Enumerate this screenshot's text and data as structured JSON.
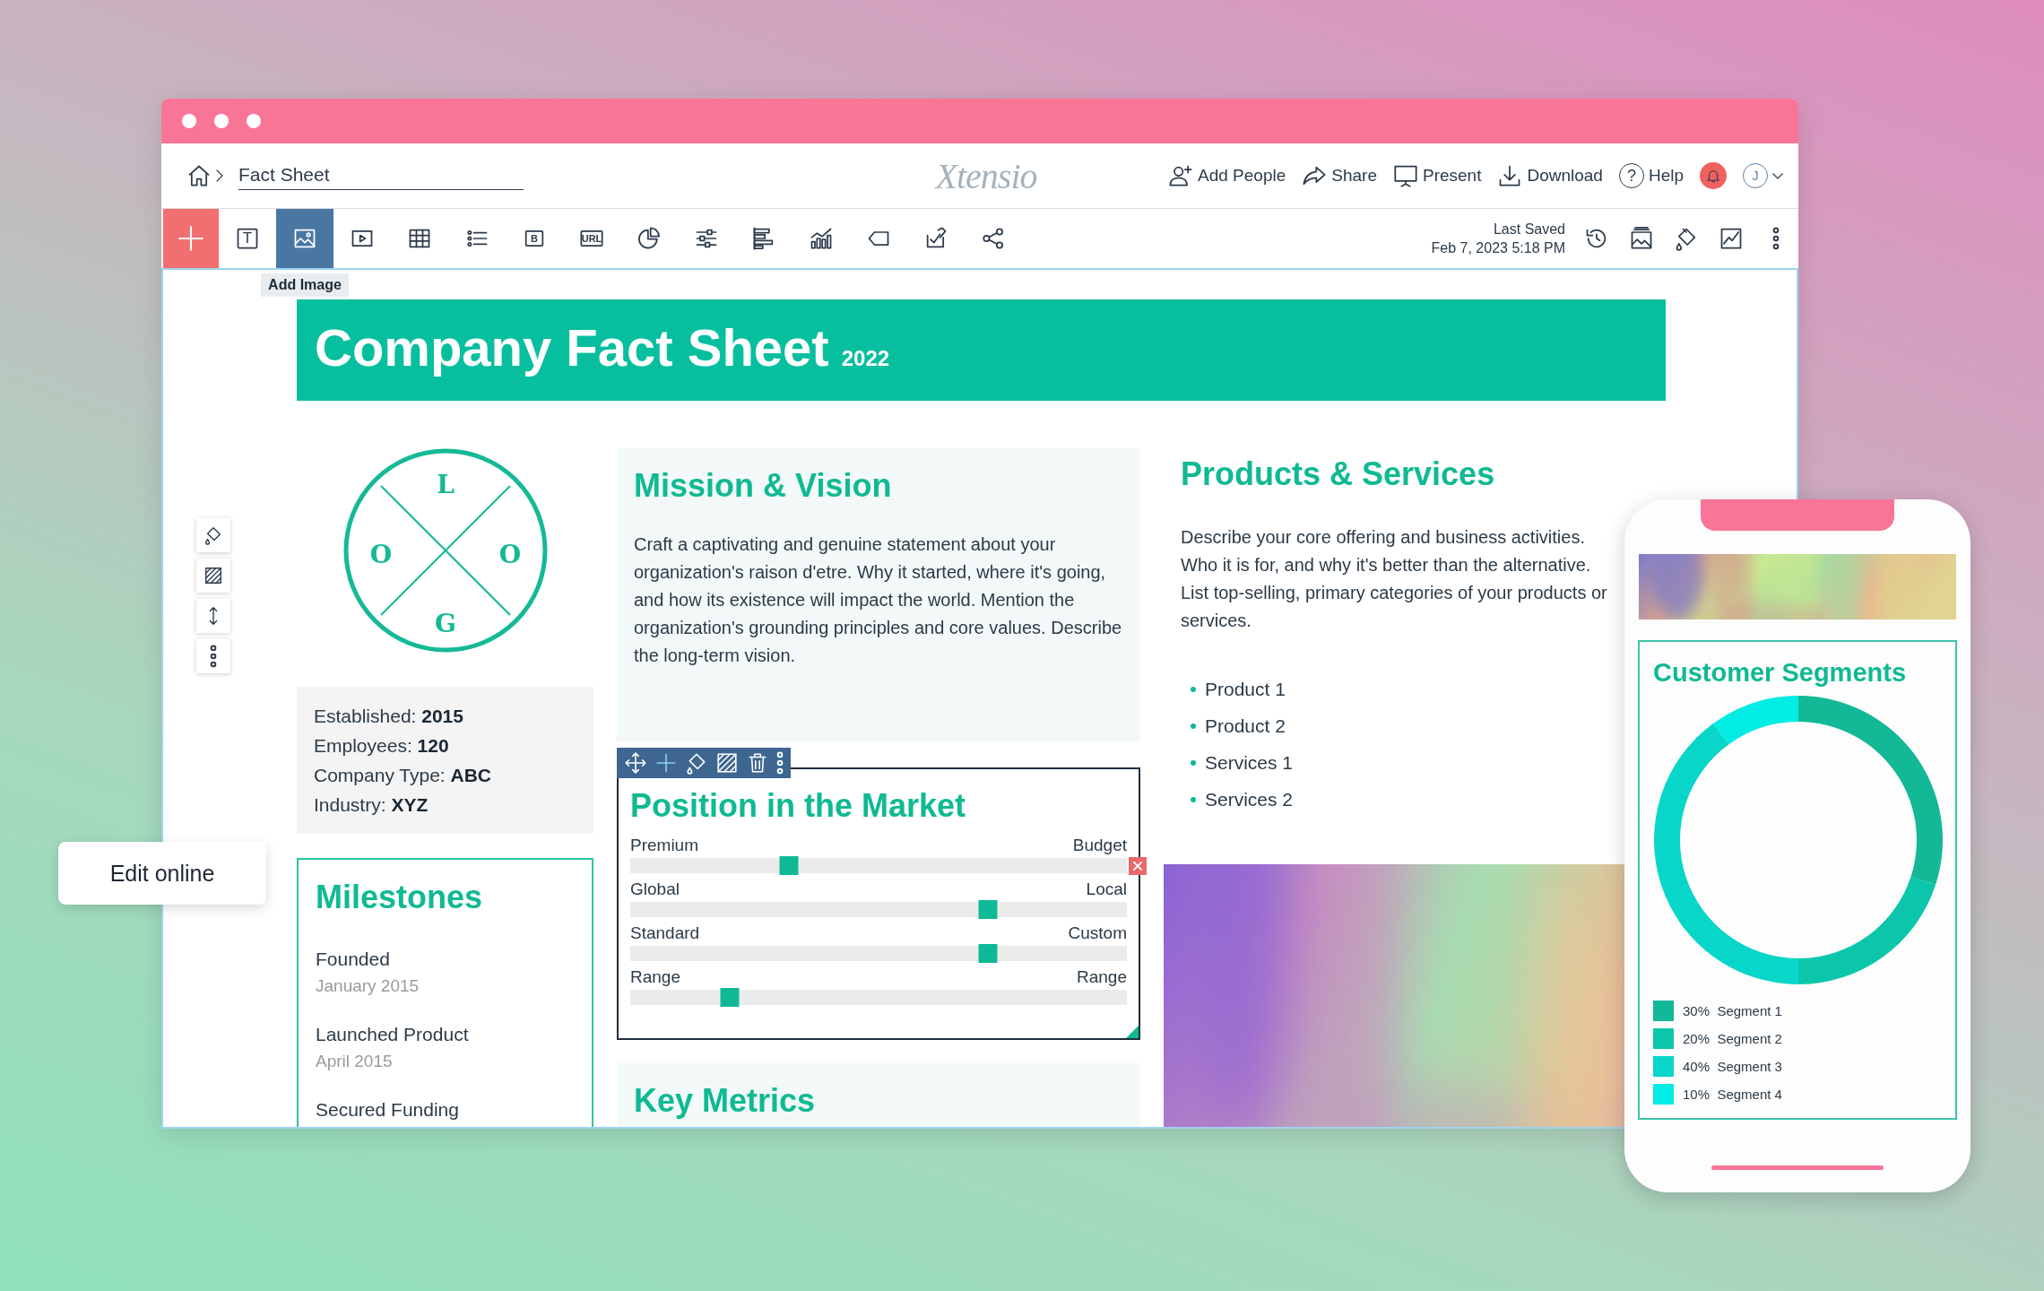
{
  "header": {
    "title_field": "Fact Sheet",
    "logo": "Xtensio",
    "actions": [
      {
        "label": "Add People"
      },
      {
        "label": "Share"
      },
      {
        "label": "Present"
      },
      {
        "label": "Download"
      },
      {
        "label": "Help",
        "glyph": "?"
      }
    ],
    "avatar_initial": "J"
  },
  "toolbar": {
    "tools": [
      {
        "selected": false,
        "glyph": "T"
      },
      {
        "selected": true,
        "tooltip": "Add Image"
      },
      {
        "selected": false
      },
      {
        "selected": false
      },
      {
        "selected": false
      },
      {
        "selected": false,
        "glyph": "B"
      },
      {
        "selected": false,
        "glyph": "URL"
      },
      {
        "selected": false
      },
      {
        "selected": false
      },
      {
        "selected": false
      },
      {
        "selected": false
      },
      {
        "selected": false
      },
      {
        "selected": false
      },
      {
        "selected": false
      }
    ],
    "last_saved_label": "Last Saved",
    "last_saved_time": "Feb 7, 2023 5:18 PM"
  },
  "document": {
    "title": "Company Fact Sheet",
    "year": "2022",
    "logo_letters": [
      "L",
      "O",
      "O",
      "G"
    ],
    "facts": [
      "Established: **2015**",
      "Employees: **120**",
      "Company Type: **ABC**",
      "Industry: **XYZ**"
    ],
    "milestones": {
      "title": "Milestones",
      "items": [
        {
          "name": "Founded",
          "date": "January 2015"
        },
        {
          "name": "Launched Product",
          "date": "April 2015"
        },
        {
          "name": "Secured Funding"
        }
      ]
    },
    "mission": {
      "title": "Mission & Vision",
      "body": "Craft a captivating and genuine statement about your organization's raison d'etre. Why it started, where it's going, and how its existence will impact the world. Mention the organization's grounding principles and core values. Describe the long-term vision."
    },
    "position": {
      "title": "Position in the Market",
      "selected": true,
      "sliders": [
        {
          "left": "Premium",
          "right": "Budget",
          "level": 0.32,
          "hovered": true
        },
        {
          "left": "Global",
          "right": "Local",
          "level": 0.72,
          "hovered": false
        },
        {
          "left": "Standard",
          "right": "Custom",
          "level": 0.72,
          "hovered": false
        },
        {
          "left": "Range",
          "right": "Range",
          "level": 0.2,
          "hovered": false
        }
      ]
    },
    "key_metrics": {
      "title": "Key Metrics"
    },
    "products": {
      "title": "Products & Services",
      "body": "Describe your core offering and business activities. Who it is for, and why it's better than the alternative. List top-selling, primary categories of your products or services.",
      "items": [
        "Product 1",
        "Product 2",
        "Services 1",
        "Services 2"
      ]
    }
  },
  "edit_online": "Edit online",
  "phone": {
    "segments": {
      "title": "Customer Segments",
      "legend": [
        {
          "percent": "30%",
          "color": "#13b896"
        },
        {
          "percent": "20%",
          "color": "#0cc6ab"
        },
        {
          "percent": "40%",
          "color": "#07d6c8"
        },
        {
          "percent": "10%",
          "color": "#00ece4"
        }
      ],
      "chart_data": {
        "type": "donut",
        "categories": [
          "Segment 1",
          "Segment 2",
          "Segment 3",
          "Segment 4"
        ],
        "values": [
          30,
          20,
          40,
          10
        ]
      }
    }
  }
}
